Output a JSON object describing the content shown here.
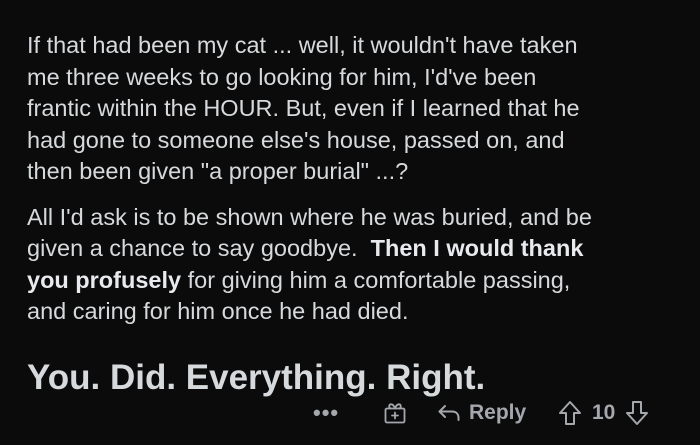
{
  "comment": {
    "paragraphs": [
      {
        "lines": [
          "If that had been my cat ... well, it wouldn't have taken",
          "me three weeks to go looking for him, I'd've been",
          "frantic within the HOUR.  But, even if I learned that he",
          "had gone to someone else's house, passed on, and",
          "then been given \"a proper burial\" ...?"
        ]
      },
      {
        "line1": "All I'd ask is to be shown where he was buried, and be",
        "line2_text": "given a chance to say goodbye.  ",
        "line2_bold": "Then I would thank",
        "line3_bold": "you profusely",
        "line3_text": " for giving him a comfortable passing,",
        "line4": "and caring for him once he had died."
      }
    ],
    "headline": "You. Did. Everything. Right."
  },
  "actions": {
    "more_label": "•••",
    "award_icon": "award-gift-icon",
    "reply_icon": "reply-arrow-icon",
    "reply_label": "Reply",
    "upvote_icon": "upvote-arrow-icon",
    "vote_count": "10",
    "downvote_icon": "downvote-arrow-icon",
    "icon_color": "#a4a7ab",
    "text_color": "#d7dadc",
    "background": "#0b0b0c"
  }
}
